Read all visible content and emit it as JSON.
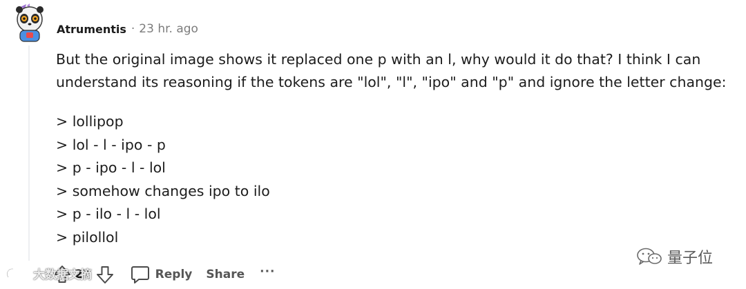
{
  "comment": {
    "username": "Atrumentis",
    "separator": "·",
    "timestamp": "23 hr. ago",
    "paragraph_lines": [
      "But the original image shows it replaced one p with an l, why would it do that? I think I can",
      "understand its reasoning if the tokens are \"lol\", \"l\", \"ipo\" and \"p\" and ignore the letter change:"
    ],
    "quote_lines": [
      "> lollipop",
      "> lol - l - ipo - p",
      "> p - ipo - l - lol",
      "> somehow changes ipo to ilo",
      "> p - ilo - l - lol",
      "> pilollol"
    ]
  },
  "actions": {
    "vote_count": "27",
    "reply_label": "Reply",
    "share_label": "Share",
    "more_label": "···"
  },
  "watermarks": {
    "left_text": "大数据文摘",
    "right_text": "量子位"
  },
  "icons": {
    "upvote": "upvote-arrow-icon",
    "downvote": "downvote-arrow-icon",
    "reply": "speech-bubble-icon",
    "avatar": "panda-avatar"
  },
  "colors": {
    "text_primary": "#1c1c1c",
    "text_meta": "#7c7c7c",
    "action_text": "#565656",
    "thread_line": "#edeff1"
  }
}
